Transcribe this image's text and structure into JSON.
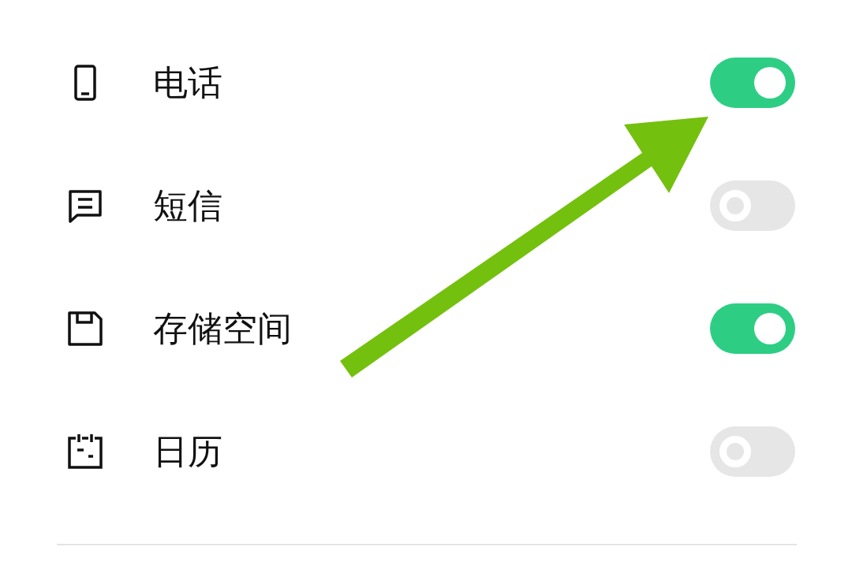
{
  "permissions": [
    {
      "kind": "phone",
      "label": "电话",
      "on": true
    },
    {
      "kind": "message",
      "label": "短信",
      "on": false
    },
    {
      "kind": "storage",
      "label": "存储空间",
      "on": true
    },
    {
      "kind": "calendar",
      "label": "日历",
      "on": false
    }
  ]
}
